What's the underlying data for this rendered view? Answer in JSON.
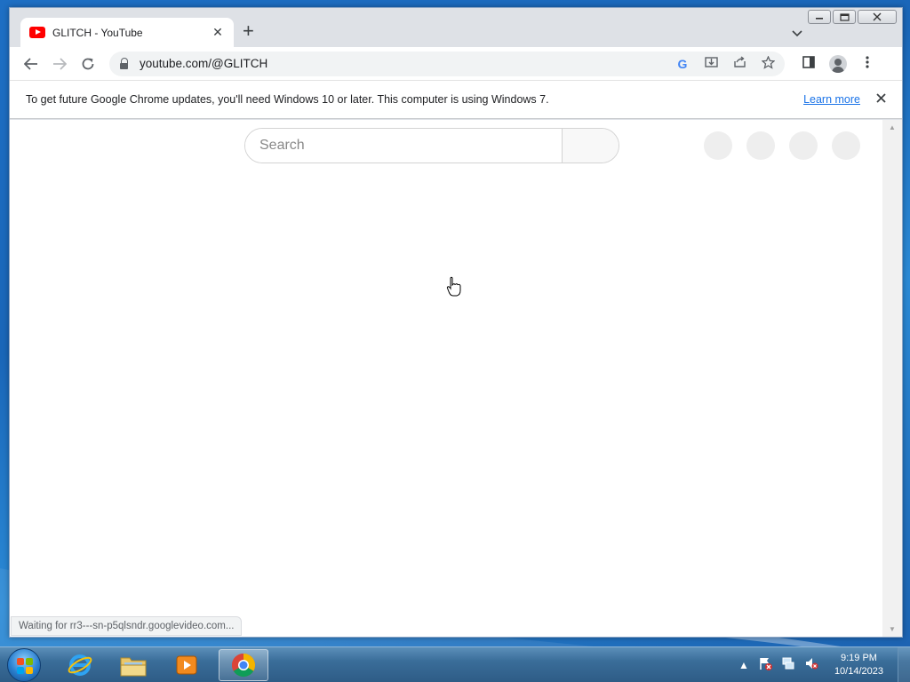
{
  "browser": {
    "tab": {
      "title": "GLITCH - YouTube",
      "close": "✕"
    },
    "new_tab": "+",
    "tab_search": "⌄",
    "window_controls": {
      "minimize": "—",
      "maximize": "▢",
      "close": "✕"
    },
    "nav": {
      "back": "←",
      "forward": "→",
      "reload": "↻"
    },
    "address": {
      "url": "youtube.com/@GLITCH"
    },
    "omnibox_icons": [
      "google-lens-icon",
      "install-icon",
      "share-icon",
      "bookmark-star-icon"
    ],
    "toolbar_icons": [
      "side-panel-icon",
      "profile-icon",
      "menu-icon"
    ],
    "infobar": {
      "message": "To get future Google Chrome updates, you'll need Windows 10 or later. This computer is using Windows 7.",
      "link": "Learn more",
      "close": "✕"
    },
    "status": "Waiting for rr3---sn-p5qlsndr.googlevideo.com..."
  },
  "page": {
    "search": {
      "placeholder": "Search"
    },
    "placeholder_count_label": ""
  },
  "taskbar": {
    "pinned": [
      "start-orb",
      "internet-explorer-icon",
      "file-explorer-icon",
      "media-player-icon",
      "chrome-icon"
    ],
    "active": "chrome-icon",
    "clock": {
      "time": "9:19 PM",
      "date": "10/14/2023"
    },
    "tray": {
      "expand": "▲"
    }
  },
  "colors": {
    "accent": "#1a73e8",
    "youtube_red": "#ff0000",
    "taskbar": "#3a6d99"
  }
}
